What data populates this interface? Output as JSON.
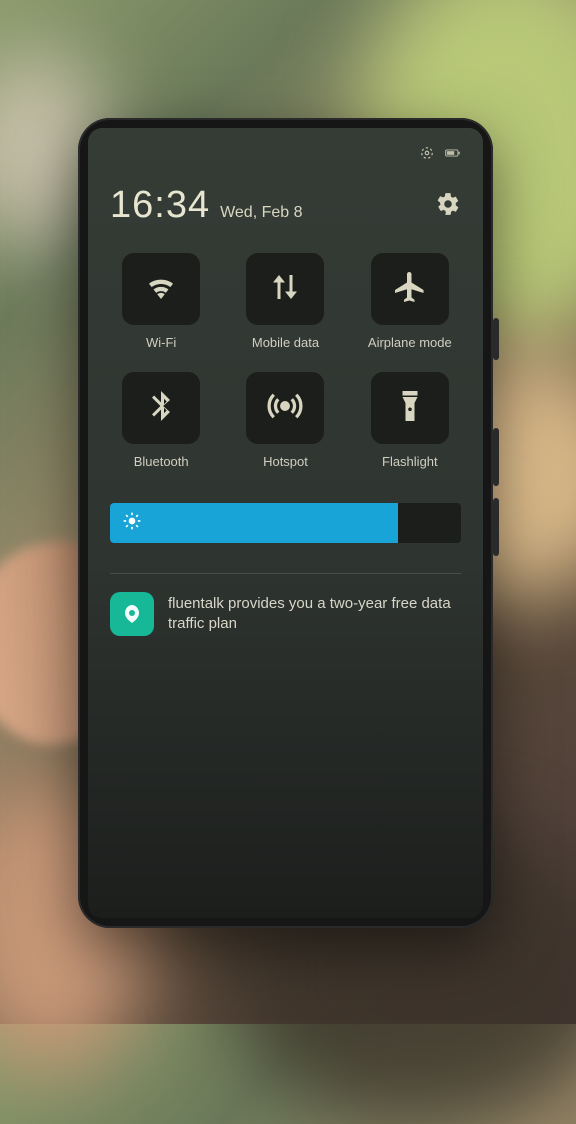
{
  "status": {
    "signal": true,
    "battery": true
  },
  "header": {
    "time": "16:34",
    "date": "Wed, Feb 8"
  },
  "tiles": {
    "wifi": "Wi-Fi",
    "mobile_data": "Mobile data",
    "airplane": "Airplane mode",
    "bluetooth": "Bluetooth",
    "hotspot": "Hotspot",
    "flashlight": "Flashlight"
  },
  "brightness": {
    "percent": 82
  },
  "notification": {
    "text": "fluentalk provides you a two-year free data traffic plan"
  },
  "colors": {
    "accent": "#19a4d8",
    "notif_icon_bg": "#16b898",
    "icon_fg": "#d8d6c0"
  }
}
